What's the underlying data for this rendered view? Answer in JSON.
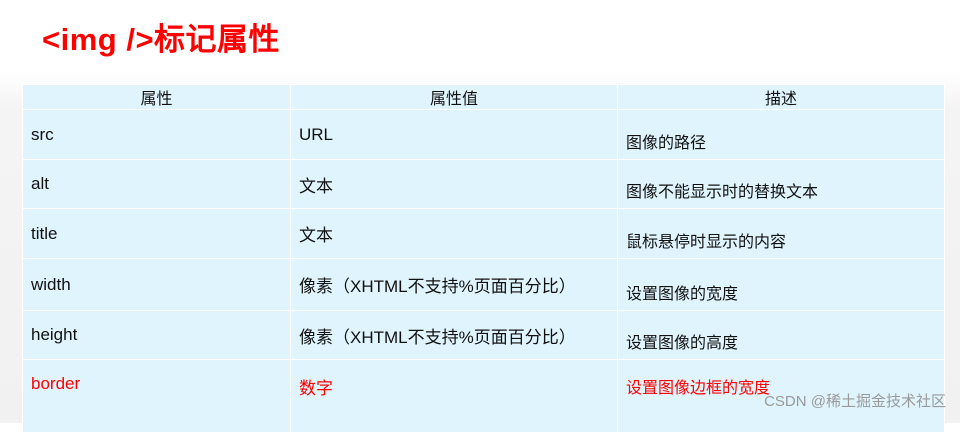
{
  "title": "<img />标记属性",
  "table": {
    "headers": [
      "属性",
      "属性值",
      "描述"
    ],
    "rows": [
      [
        "src",
        "URL",
        "图像的路径"
      ],
      [
        "alt",
        "文本",
        "图像不能显示时的替换文本"
      ],
      [
        "title",
        "文本",
        "鼠标悬停时显示的内容"
      ],
      [
        "width",
        "像素（XHTML不支持%页面百分比）",
        "设置图像的宽度"
      ],
      [
        "height",
        "像素（XHTML不支持%页面百分比）",
        "设置图像的高度"
      ],
      [
        "border",
        "数字",
        "设置图像边框的宽度"
      ]
    ],
    "highlight_row_color": "#ff0000"
  },
  "watermark": "CSDN @稀土掘金技术社区",
  "colors": {
    "title": "#ff0000",
    "cell_background": "#dff4fd",
    "border": "#ffffff"
  }
}
